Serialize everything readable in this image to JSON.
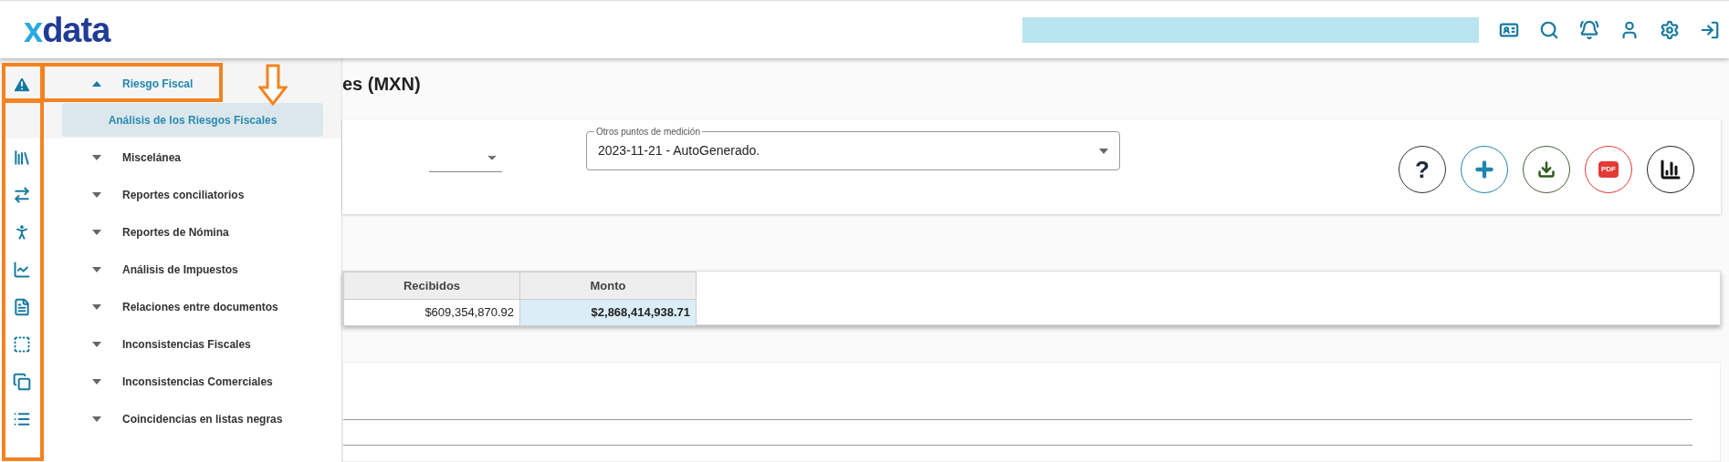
{
  "header": {
    "logo": "xdata"
  },
  "menu": {
    "items": [
      {
        "label": "Riesgo Fiscal",
        "expanded": true,
        "children": [
          {
            "label": "Análisis de los Riesgos Fiscales",
            "selected": true
          }
        ]
      },
      {
        "label": "Miscelánea",
        "expanded": false
      },
      {
        "label": "Reportes conciliatorios",
        "expanded": false
      },
      {
        "label": "Reportes de Nómina",
        "expanded": false
      },
      {
        "label": "Análisis de Impuestos",
        "expanded": false
      },
      {
        "label": "Relaciones entre documentos",
        "expanded": false
      },
      {
        "label": "Inconsistencias Fiscales",
        "expanded": false
      },
      {
        "label": "Inconsistencias Comerciales",
        "expanded": false
      },
      {
        "label": "Coincidencias en listas negras",
        "expanded": false
      }
    ]
  },
  "page": {
    "title": "es (MXN)"
  },
  "filters": {
    "measurement_select": {
      "label": "Otros puntos de medición",
      "value": "2023-11-21 - AutoGenerado."
    }
  },
  "actions": [
    {
      "kind": "help",
      "text": "?"
    },
    {
      "kind": "add"
    },
    {
      "kind": "download"
    },
    {
      "kind": "pdf",
      "text": "PDF"
    },
    {
      "kind": "chart"
    }
  ],
  "summary_table": {
    "columns": [
      "Recibidos",
      "Monto"
    ],
    "rows": [
      [
        {
          "text": "$609,354,870.92",
          "selected": false
        },
        {
          "text": "$2,868,414,938.71",
          "selected": true
        }
      ]
    ]
  }
}
